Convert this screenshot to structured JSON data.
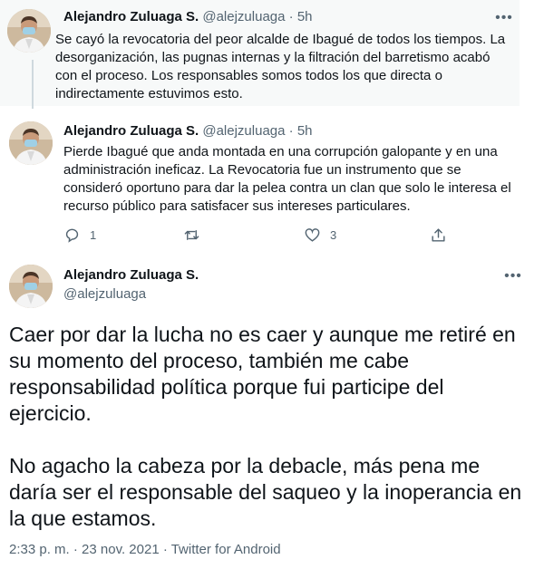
{
  "tweets": [
    {
      "name": "Alejandro Zuluaga S.",
      "handle": "@alejzuluaga",
      "sep": "·",
      "time": "5h",
      "text": "Se cayó la revocatoria del peor alcalde de Ibagué de todos los tiempos. La\ndesorganización, las pugnas internas y la filtración del barretismo acabó\ncon el proceso. Los responsables somos todos los que directa o\nindirectamente estuvimos esto."
    },
    {
      "name": "Alejandro Zuluaga S.",
      "handle": "@alejzuluaga",
      "sep": "·",
      "time": "5h",
      "text": "Pierde Ibagué que anda montada en una corrupción galopante y en una\nadministración ineficaz. La Revocatoria fue un instrumento que se\nconsideró oportuno para dar la pelea contra un clan que solo le interesa el\nrecurso público para satisfacer sus intereses particulares.",
      "actions": {
        "reply_count": "1",
        "retweet_count": "",
        "like_count": "3"
      }
    }
  ],
  "main_tweet": {
    "name": "Alejandro Zuluaga S.",
    "handle": "@alejzuluaga",
    "paragraph1": "Caer por dar la lucha no es caer y aunque me retiré en su momento del proceso, también me cabe responsabilidad política porque fui participe del ejercicio.",
    "paragraph2": "No agacho la cabeza por la debacle, más pena me daría ser el responsable del saqueo y la inoperancia  en la que estamos.",
    "meta": "2:33 p. m. · 23 nov. 2021 · Twitter for Android"
  },
  "icons": {
    "more": "more-icon",
    "reply": "reply-icon",
    "retweet": "retweet-icon",
    "like": "like-icon",
    "share": "share-icon"
  },
  "colors": {
    "secondary_text": "#536471",
    "highlight_bg": "#f7f9f9",
    "thread_line": "#cfd9de"
  }
}
